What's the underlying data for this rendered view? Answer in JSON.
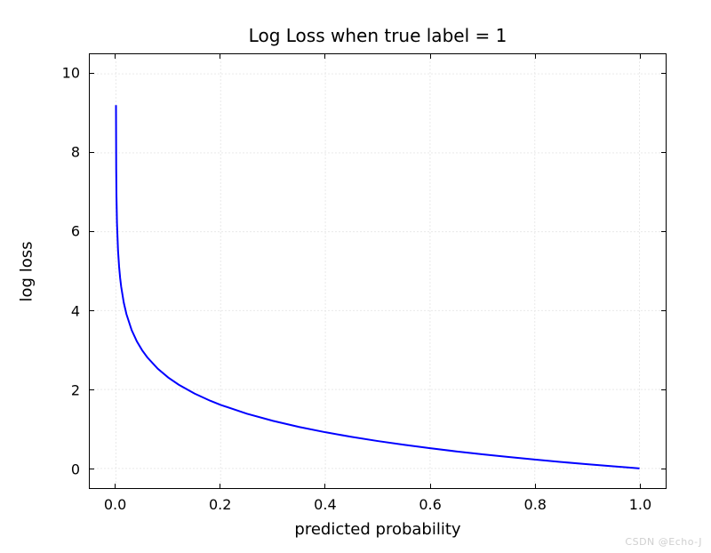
{
  "chart_data": {
    "type": "line",
    "title": "Log Loss when true label = 1",
    "xlabel": "predicted probability",
    "ylabel": "log loss",
    "xlim": [
      -0.05,
      1.05
    ],
    "ylim": [
      -0.5,
      10.5
    ],
    "xticks": [
      0.0,
      0.2,
      0.4,
      0.6,
      0.8,
      1.0
    ],
    "yticks": [
      0,
      2,
      4,
      6,
      8,
      10
    ],
    "grid": true,
    "x": [
      0.0001,
      0.0005,
      0.001,
      0.002,
      0.004,
      0.006,
      0.008,
      0.01,
      0.015,
      0.02,
      0.03,
      0.04,
      0.05,
      0.06,
      0.08,
      0.1,
      0.12,
      0.15,
      0.18,
      0.2,
      0.25,
      0.3,
      0.35,
      0.4,
      0.45,
      0.5,
      0.55,
      0.6,
      0.65,
      0.7,
      0.75,
      0.8,
      0.85,
      0.9,
      0.95,
      0.98,
      0.99,
      1.0
    ],
    "y": [
      9.2103,
      7.6009,
      6.9078,
      6.2146,
      5.5215,
      5.116,
      4.8283,
      4.6052,
      4.1997,
      3.912,
      3.5066,
      3.2189,
      2.9957,
      2.8134,
      2.5257,
      2.3026,
      2.1203,
      1.8971,
      1.7148,
      1.6094,
      1.3863,
      1.204,
      1.0498,
      0.9163,
      0.7985,
      0.6931,
      0.5978,
      0.5108,
      0.4308,
      0.3567,
      0.2877,
      0.2231,
      0.1625,
      0.1054,
      0.0513,
      0.0202,
      0.0101,
      0.0
    ]
  },
  "xtick_labels": [
    "0.0",
    "0.2",
    "0.4",
    "0.6",
    "0.8",
    "1.0"
  ],
  "ytick_labels": [
    "0",
    "2",
    "4",
    "6",
    "8",
    "10"
  ],
  "watermark": "CSDN @Echo-J"
}
